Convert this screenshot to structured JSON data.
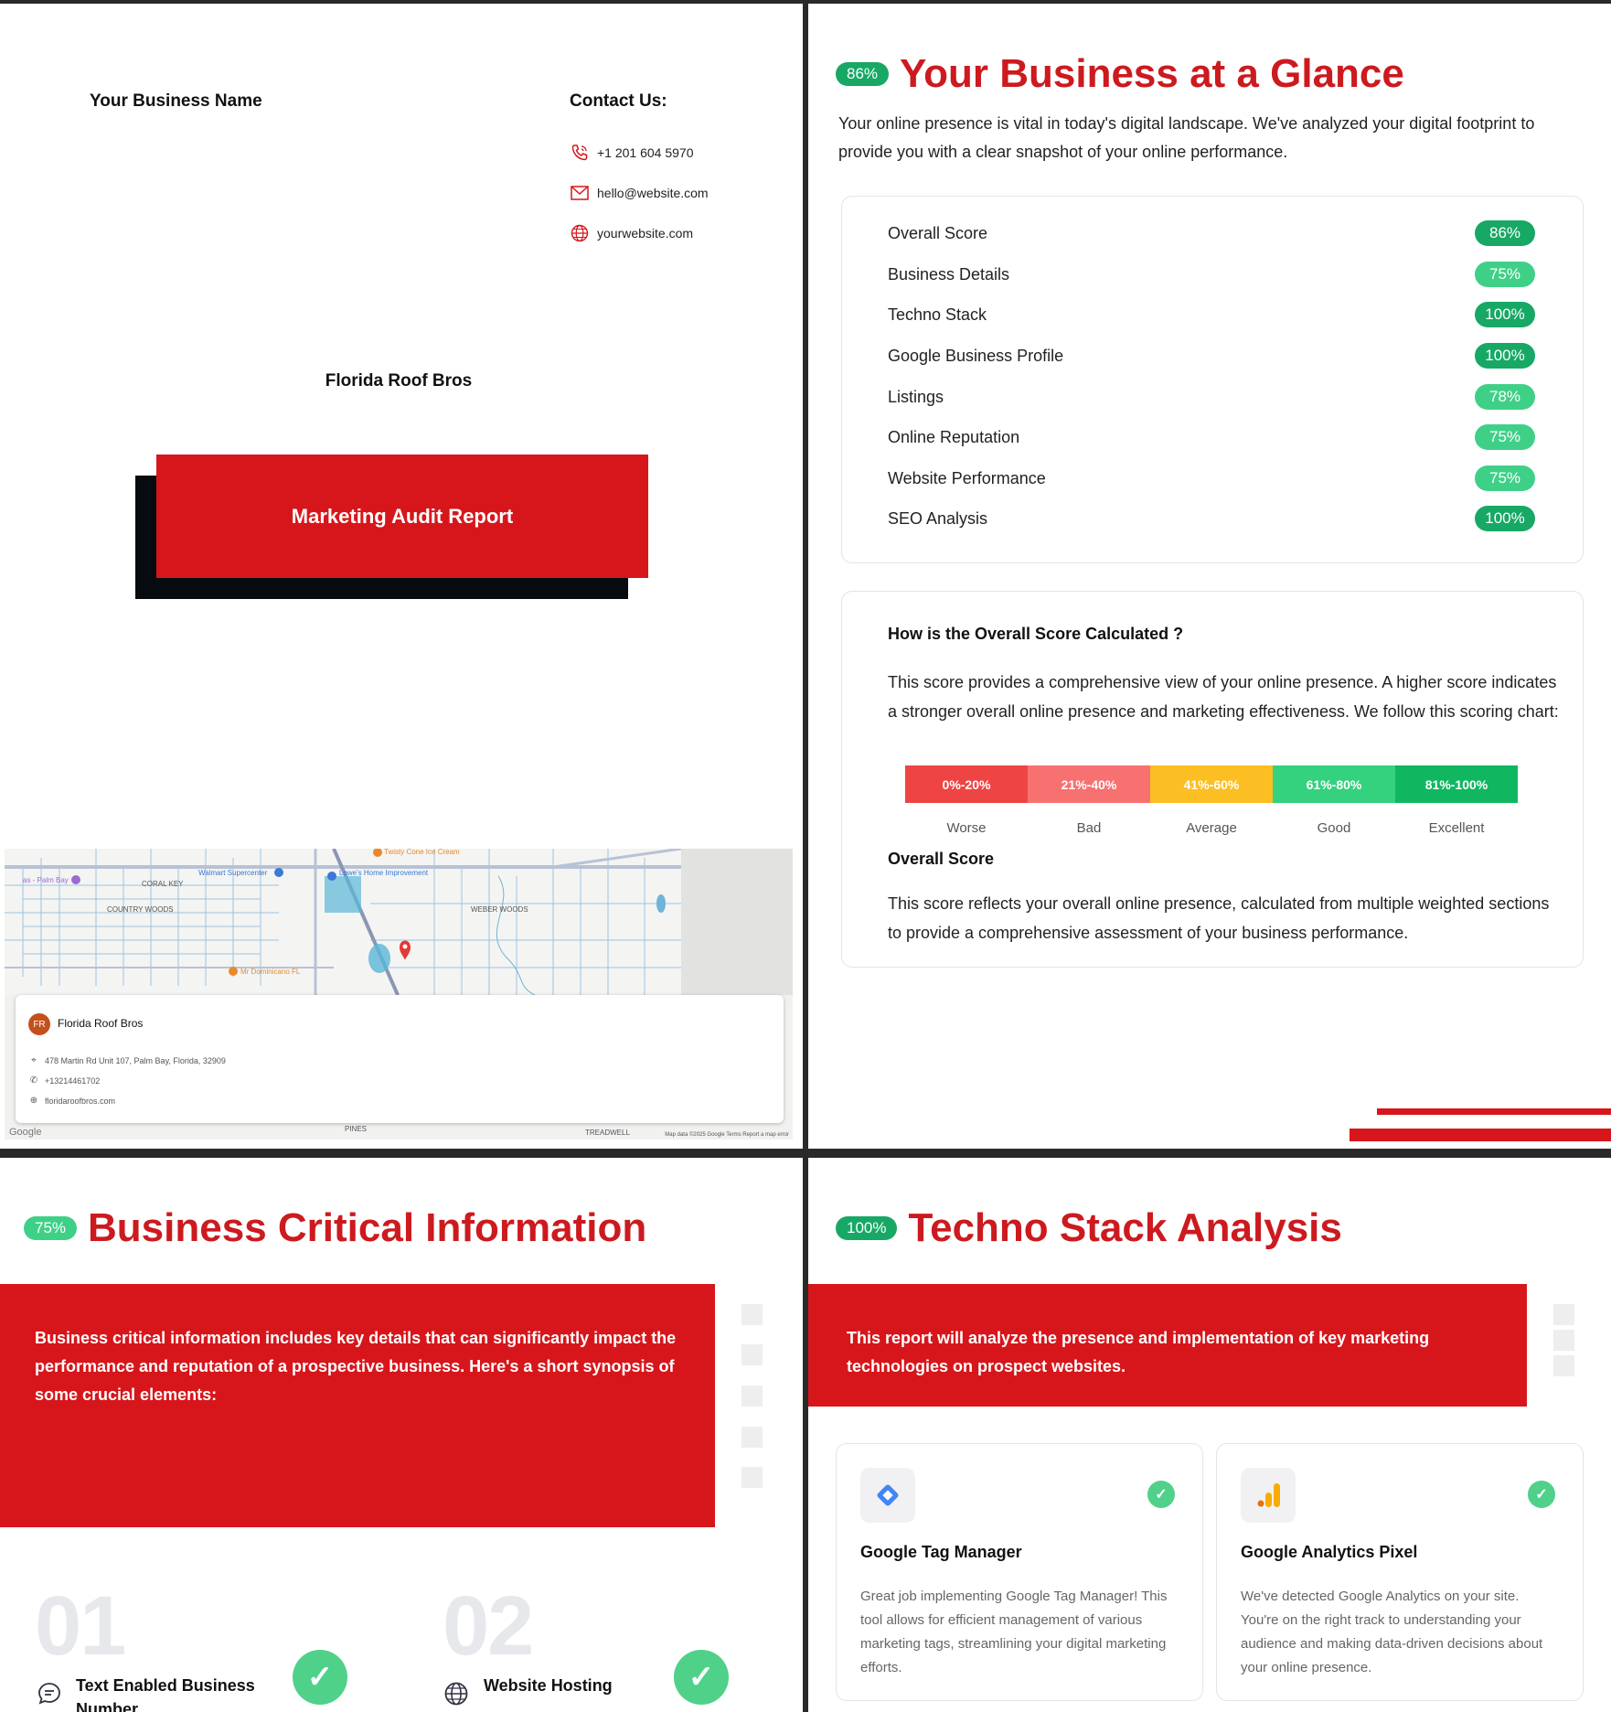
{
  "cover": {
    "business_name": "Your Business Name",
    "contact_title": "Contact Us:",
    "phone": "+1 201 604 5970",
    "email": "hello@website.com",
    "website": "yourwebsite.com",
    "client_name": "Florida Roof Bros",
    "report_title": "Marketing Audit Report",
    "map": {
      "business_initials": "FR",
      "business_name": "Florida Roof Bros",
      "address": "478 Martin Rd Unit 107, Palm Bay, Florida, 32909",
      "phone": "+13214461702",
      "website": "floridaroofbros.com",
      "provider": "Google",
      "labels": {
        "coral_key": "CORAL KEY",
        "country_woods": "COUNTRY WOODS",
        "weber_woods": "WEBER WOODS",
        "walmart": "Walmart Supercenter",
        "lowes": "Lowe's Home Improvement",
        "twisty": "Twisty Cone Ice Cream",
        "mr_dominicano": "Mr Dominicano FL",
        "pines": "PINES",
        "treadwell": "TREADWELL",
        "palm_bay": "as - Palm Bay"
      },
      "credit": "Map data ©2025 Google   Terms   Report a map error"
    }
  },
  "glance": {
    "badge": "86%",
    "title": "Your Business at a Glance",
    "intro": "Your online presence is vital in today's digital landscape. We've analyzed your digital footprint to provide you with a clear snapshot of your online performance.",
    "scores": [
      {
        "label": "Overall Score",
        "value": "86%",
        "color": "#17a865"
      },
      {
        "label": "Business Details",
        "value": "75%",
        "color": "#3fd088"
      },
      {
        "label": "Techno Stack",
        "value": "100%",
        "color": "#17a865"
      },
      {
        "label": "Google Business Profile",
        "value": "100%",
        "color": "#17a865"
      },
      {
        "label": "Listings",
        "value": "78%",
        "color": "#3fd088"
      },
      {
        "label": "Online Reputation",
        "value": "75%",
        "color": "#3fd088"
      },
      {
        "label": "Website Performance",
        "value": "75%",
        "color": "#3fd088"
      },
      {
        "label": "SEO Analysis",
        "value": "100%",
        "color": "#17a865"
      }
    ],
    "calc_title": "How is the Overall Score Calculated ?",
    "calc_text": "This score provides a comprehensive view of your online presence. A higher score indicates a stronger overall online presence and marketing effectiveness. We follow this scoring chart:",
    "scale": [
      {
        "range": "0%-20%",
        "label": "Worse",
        "color": "#ef4444"
      },
      {
        "range": "21%-40%",
        "label": "Bad",
        "color": "#f87171"
      },
      {
        "range": "41%-60%",
        "label": "Average",
        "color": "#fbbf24"
      },
      {
        "range": "61%-80%",
        "label": "Good",
        "color": "#34d17f"
      },
      {
        "range": "81%-100%",
        "label": "Excellent",
        "color": "#10b760"
      }
    ],
    "overall_title": "Overall Score",
    "overall_text": "This score reflects your overall online presence, calculated from multiple weighted sections to provide a comprehensive assessment of your business performance."
  },
  "critical": {
    "badge": "75%",
    "title": "Business Critical Information",
    "intro": "Business critical information includes key details that can significantly impact the performance and reputation of a prospective business. Here's a short synopsis of some crucial elements:",
    "items": [
      {
        "num": "01",
        "label": "Text Enabled Business Number",
        "icon": "chat-icon"
      },
      {
        "num": "02",
        "label": "Website Hosting",
        "icon": "globe-icon"
      }
    ]
  },
  "techno": {
    "badge": "100%",
    "title": "Techno Stack Analysis",
    "intro": "This report will analyze the presence and implementation of key marketing technologies on prospect websites.",
    "cards": [
      {
        "title": "Google Tag Manager",
        "desc": "Great job implementing Google Tag Manager! This tool allows for efficient management of various marketing tags, streamlining your digital marketing efforts.",
        "icon": "google-tag-manager-icon"
      },
      {
        "title": "Google Analytics Pixel",
        "desc": "We've detected Google Analytics on your site. You're on the right track to understanding your audience and making data-driven decisions about your online presence.",
        "icon": "google-analytics-icon"
      }
    ]
  },
  "colors": {
    "accent": "#d7161b",
    "heading_red": "#cc1a1f",
    "badge_green": "#17a865",
    "check_green": "#4fd18a"
  }
}
